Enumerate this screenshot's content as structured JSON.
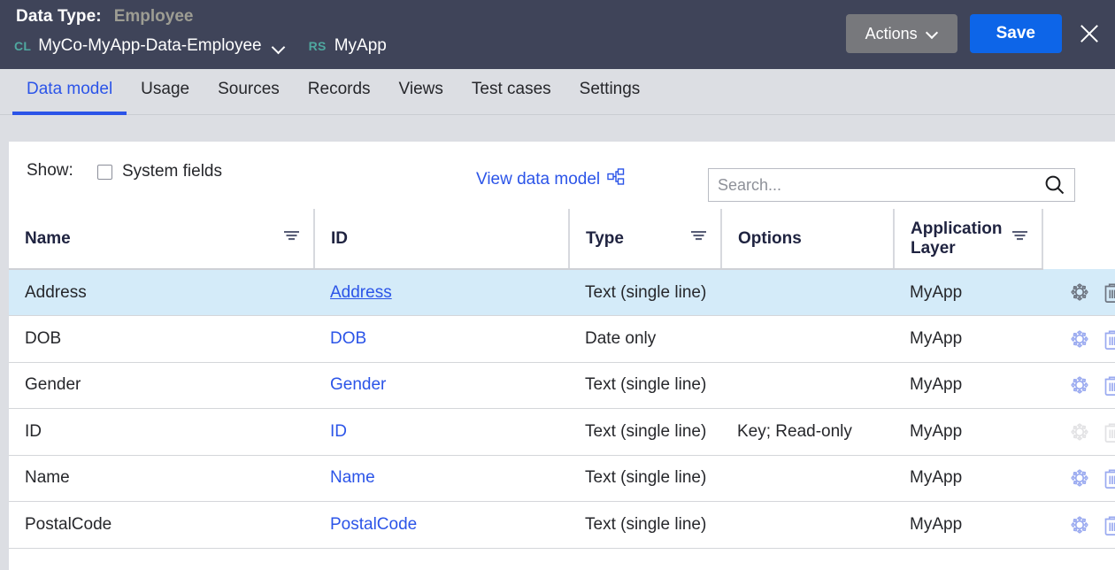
{
  "header": {
    "data_type_label": "Data Type:",
    "data_type_value": "Employee",
    "class_badge": "CL",
    "class_name": "MyCo-MyApp-Data-Employee",
    "ruleset_badge": "RS",
    "ruleset_name": "MyApp",
    "actions_label": "Actions",
    "save_label": "Save",
    "close_icon": "close-icon",
    "dropdown_icon": "chevron-down-icon",
    "bg_color": "#3f4459",
    "save_color": "#0d65e8",
    "badge_color": "#4fa8a0"
  },
  "tabs": [
    {
      "label": "Data model",
      "active": true
    },
    {
      "label": "Usage",
      "active": false
    },
    {
      "label": "Sources",
      "active": false
    },
    {
      "label": "Records",
      "active": false
    },
    {
      "label": "Views",
      "active": false
    },
    {
      "label": "Test cases",
      "active": false
    },
    {
      "label": "Settings",
      "active": false
    }
  ],
  "toolbar": {
    "show_label": "Show:",
    "system_fields_label": "System fields",
    "system_fields_checked": false,
    "view_data_model_label": "View data model",
    "view_data_model_icon": "data-model-graph-icon",
    "accent_color": "#2b54e8"
  },
  "search": {
    "placeholder": "Search...",
    "value": "",
    "icon": "search-icon"
  },
  "table": {
    "columns": [
      {
        "label": "Name",
        "filterable": true
      },
      {
        "label": "ID",
        "filterable": false
      },
      {
        "label": "Type",
        "filterable": true
      },
      {
        "label": "Options",
        "filterable": false
      },
      {
        "label": "Application Layer",
        "filterable": true
      },
      {
        "label": "",
        "filterable": false
      }
    ],
    "row_actions": {
      "settings_icon": "gear-icon",
      "delete_icon": "trash-icon"
    },
    "rows": [
      {
        "name": "Address",
        "id": "Address",
        "type": "Text (single line)",
        "options": "",
        "application_layer": "MyApp",
        "selected": true,
        "actions_enabled": true
      },
      {
        "name": "DOB",
        "id": "DOB",
        "type": "Date only",
        "options": "",
        "application_layer": "MyApp",
        "selected": false,
        "actions_enabled": true
      },
      {
        "name": "Gender",
        "id": "Gender",
        "type": "Text (single line)",
        "options": "",
        "application_layer": "MyApp",
        "selected": false,
        "actions_enabled": true
      },
      {
        "name": "ID",
        "id": "ID",
        "type": "Text (single line)",
        "options": "Key; Read-only",
        "application_layer": "MyApp",
        "selected": false,
        "actions_enabled": false
      },
      {
        "name": "Name",
        "id": "Name",
        "type": "Text (single line)",
        "options": "",
        "application_layer": "MyApp",
        "selected": false,
        "actions_enabled": true
      },
      {
        "name": "PostalCode",
        "id": "PostalCode",
        "type": "Text (single line)",
        "options": "",
        "application_layer": "MyApp",
        "selected": false,
        "actions_enabled": true
      }
    ]
  }
}
